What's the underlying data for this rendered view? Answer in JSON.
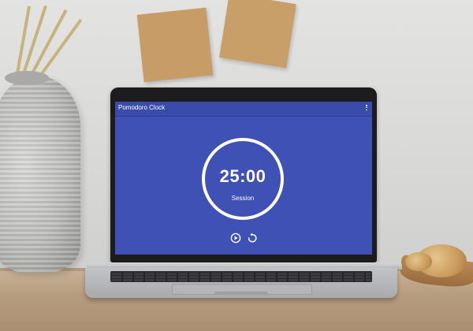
{
  "app": {
    "title": "Pomodoro Clock",
    "menu_icon": "more-vert-icon"
  },
  "timer": {
    "time": "25:00",
    "mode_label": "Session"
  },
  "controls": {
    "play_icon": "play-circle-icon",
    "reset_icon": "replay-icon"
  },
  "colors": {
    "primary": "#3f51b5",
    "app_bar": "#3a4bac",
    "foreground": "#ffffff"
  }
}
